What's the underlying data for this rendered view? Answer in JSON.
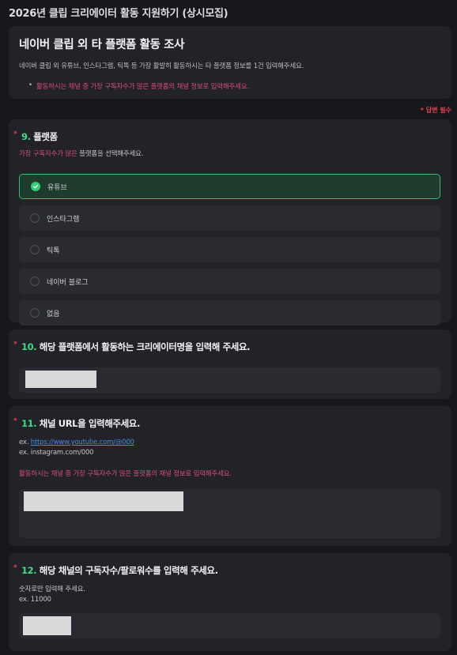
{
  "page_title": "2026년 클립 크리에이터 활동 지원하기 (상시모집)",
  "intro": {
    "heading": "네이버 클립 외 타 플랫폼 활동 조사",
    "description": "네이버 클립 외 유튜브, 인스타그램, 틱톡 등 가장 활발히 활동하시는 타 플랫폼 정보를 1건 입력해주세요.",
    "notice": "활동하시는 채널 중 가장 구독자수가 많은 플랫폼의 채널 정보로 입력해주세요."
  },
  "required_note": "* 답변 필수",
  "q9": {
    "number": "9.",
    "title": "플랫폼",
    "sub_highlight": "가장 구독자수가 많은",
    "sub_rest": " 플랫폼을 선택해주세요.",
    "options": [
      "유튜브",
      "인스타그램",
      "틱톡",
      "네이버 블로그",
      "없음"
    ],
    "selected": "유튜브"
  },
  "q10": {
    "number": "10.",
    "title": "해당 플랫폼에서 활동하는 크리에이터명을 입력해 주세요."
  },
  "q11": {
    "number": "11.",
    "title": "채널 URL을 입력해주세요.",
    "example_prefix": "ex. ",
    "example_link": "https://www.youtube.com/@000",
    "example2": "ex. instagram.com/000",
    "notice": "활동하시는 채널 중 가장 구독자수가 많은 플랫폼의 채널 정보로 입력해주세요."
  },
  "q12": {
    "number": "12.",
    "title": "해당 채널의 구독자수/팔로워수를 입력해 주세요.",
    "hint": "숫자로만 입력해 주세요.",
    "example": "ex. 11000"
  },
  "colors": {
    "accent_green": "#3ddc84",
    "required_red": "#e8404f",
    "notice_pink": "#d94a7a"
  }
}
